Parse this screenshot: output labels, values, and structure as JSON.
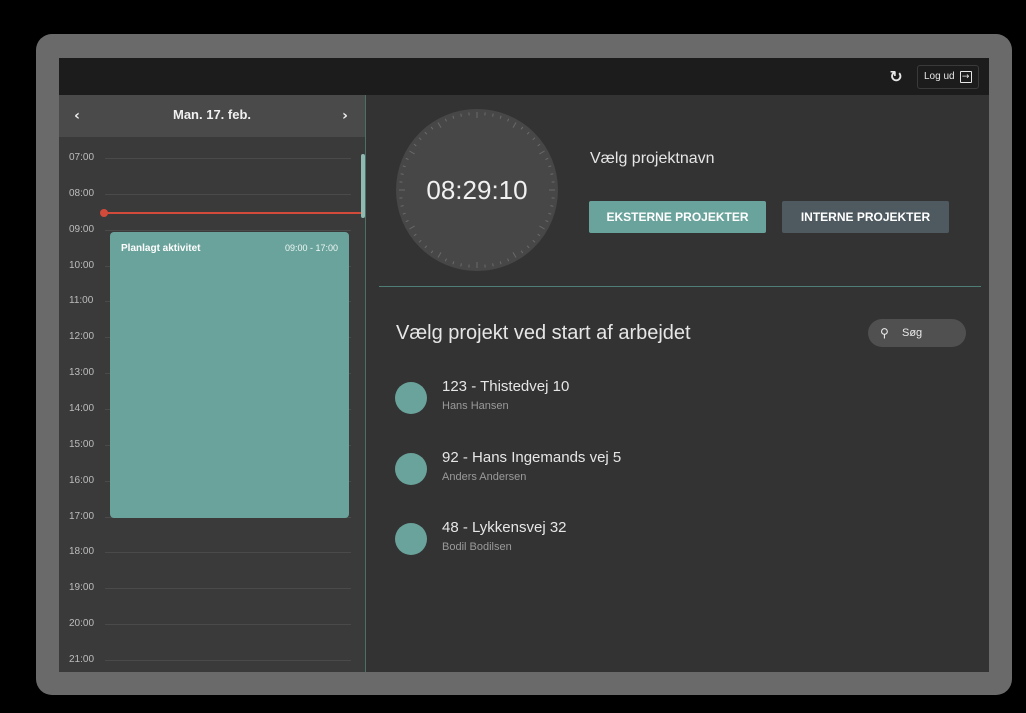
{
  "topbar": {
    "refresh_icon": "refresh-icon",
    "logout_label": "Log ud",
    "logout_icon": "logout-icon"
  },
  "calendar": {
    "prev_label": "‹",
    "next_label": "›",
    "date": "Man. 17. feb.",
    "hours": [
      "07:00",
      "08:00",
      "09:00",
      "10:00",
      "11:00",
      "12:00",
      "13:00",
      "14:00",
      "15:00",
      "16:00",
      "17:00",
      "18:00",
      "19:00",
      "20:00",
      "21:00"
    ],
    "event": {
      "title": "Planlagt aktivitet",
      "time": "09:00 - 17:00"
    },
    "colors": {
      "now_line": "#d24a3a",
      "event": "#6aa39b"
    }
  },
  "timer": {
    "time": "08:29:10"
  },
  "project_picker": {
    "title": "Vælg projektnavn",
    "external_button": "EKSTERNE PROJEKTER",
    "internal_button": "INTERNE PROJEKTER"
  },
  "projects": {
    "heading": "Vælg projekt ved start af arbejdet",
    "search_label": "Søg",
    "items": [
      {
        "title": "123 - Thistedvej 10",
        "subtitle": "Hans  Hansen"
      },
      {
        "title": "92 - Hans Ingemands vej 5",
        "subtitle": "Anders Andersen"
      },
      {
        "title": "48 - Lykkensvej 32",
        "subtitle": "Bodil Bodilsen"
      }
    ]
  },
  "colors": {
    "accent": "#6aa39b",
    "background": "#333333",
    "secondary_button": "#4e5a60"
  }
}
